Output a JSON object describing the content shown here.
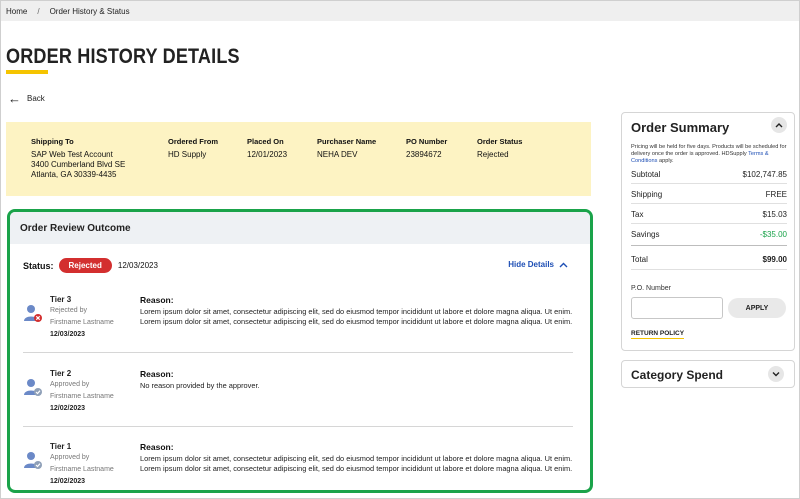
{
  "breadcrumb": {
    "home": "Home",
    "separator": "/",
    "current": "Order History & Status"
  },
  "page": {
    "title": "ORDER HISTORY DETAILS",
    "back_label": "Back"
  },
  "order_info": {
    "shipping_to": {
      "label": "Shipping To",
      "lines": [
        "SAP Web Test Account",
        "3400 Cumberland Blvd SE",
        "Atlanta, GA 30339-4435"
      ]
    },
    "ordered_from": {
      "label": "Ordered From",
      "value": "HD Supply"
    },
    "placed_on": {
      "label": "Placed On",
      "value": "12/01/2023"
    },
    "purchaser_name": {
      "label": "Purchaser Name",
      "value": "NEHA DEV"
    },
    "po_number": {
      "label": "PO Number",
      "value": "23894672"
    },
    "order_status": {
      "label": "Order Status",
      "value": "Rejected"
    }
  },
  "review": {
    "title": "Order Review Outcome",
    "status_label": "Status:",
    "status_value": "Rejected",
    "status_date": "12/03/2023",
    "hide_details": "Hide Details",
    "reason_label": "Reason:",
    "tiers": [
      {
        "name": "Tier 3",
        "action": "Rejected by",
        "user": "Firstname Lastname",
        "date": "12/03/2023",
        "reason": "Lorem ipsum dolor sit amet, consectetur adipiscing elit, sed do eiusmod tempor incididunt ut labore et dolore magna aliqua. Ut enim. Lorem ipsum dolor sit amet, consectetur adipiscing elit, sed do eiusmod tempor incididunt ut labore et dolore magna aliqua. Ut enim."
      },
      {
        "name": "Tier 2",
        "action": "Approved by",
        "user": "Firstname Lastname",
        "date": "12/02/2023",
        "reason": "No reason provided by the approver."
      },
      {
        "name": "Tier 1",
        "action": "Approved by",
        "user": "Firstname Lastname",
        "date": "12/02/2023",
        "reason": "Lorem ipsum dolor sit amet, consectetur adipiscing elit, sed do eiusmod tempor incididunt ut labore et dolore magna aliqua. Ut enim. Lorem ipsum dolor sit amet, consectetur adipiscing elit, sed do eiusmod tempor incididunt ut labore et dolore magna aliqua. Ut enim."
      }
    ]
  },
  "summary": {
    "title": "Order Summary",
    "note_text": "Pricing will be held for five days. Products will be scheduled for delivery once the order is approved. HDSupply",
    "note_link": "Terms & Conditions",
    "note_end": "apply.",
    "subtotal_label": "Subtotal",
    "subtotal": "$102,747.85",
    "shipping_label": "Shipping",
    "shipping": "FREE",
    "tax_label": "Tax",
    "tax": "$15.03",
    "savings_label": "Savings",
    "savings": "-$35.00",
    "total_label": "Total",
    "total": "$99.00",
    "po_label": "P.O. Number",
    "apply_label": "APPLY",
    "return_policy": "RETURN POLICY"
  },
  "category": {
    "title": "Category Spend"
  },
  "colors": {
    "accent_yellow": "#f5c400",
    "rejected_red": "#d32f2f",
    "highlight_green": "#1aa34a",
    "link_blue": "#1e4fb5"
  }
}
